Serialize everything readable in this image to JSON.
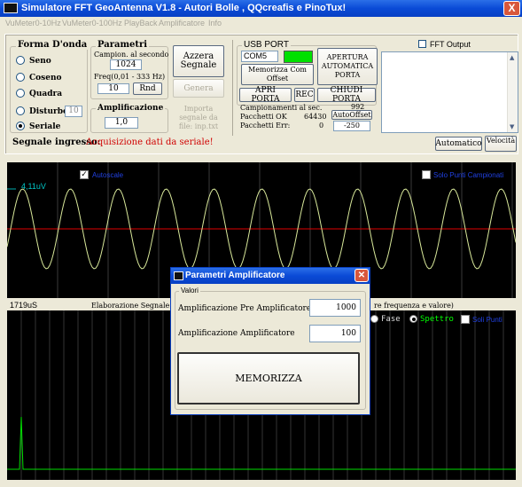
{
  "window": {
    "title": "Simulatore FFT GeoAntenna V1.8 - Autori Bolle , QQcreafis e PinoTux!",
    "close": "X"
  },
  "menu": [
    "VuMeter0-10Hz",
    "VuMeter0-100Hz",
    "PlayBack",
    "Amplificatore",
    "Info"
  ],
  "forma": {
    "title": "Forma D'onda",
    "options": [
      "Seno",
      "Coseno",
      "Quadra",
      "Disturbo",
      "Seriale"
    ],
    "selected": "Seriale",
    "disturbo_value": "10"
  },
  "parametri": {
    "title": "Parametri",
    "campion_label": "Campion. al secondo",
    "campion_value": "1024",
    "freq_label": "Freq(0,01 -  333  Hz)",
    "freq_value": "10",
    "rnd": "Rnd",
    "ampl_title": "Amplificazione",
    "ampl_value": "1,0"
  },
  "buttons": {
    "azzera": "Azzera Segnale",
    "genera": "Genera",
    "importa": "Importa segnale da file: inp.txt",
    "memorizza_com": "Memorizza Com Offset",
    "apertura": "APERTURA AUTOMATICA PORTA",
    "apri": "APRI PORTA",
    "rec": "REC",
    "chiudi": "CHIUDI PORTA",
    "autooffset": "AutoOffset",
    "automatico": "Automatico",
    "velocita": "Velocità"
  },
  "usb": {
    "title": "USB PORT",
    "com": "COM5",
    "camp_label": "Campionamenti al sec.",
    "camp_value": "992",
    "ok_label": "Pacchetti OK",
    "ok_value": "64430",
    "err_label": "Pacchetti Err:",
    "err_value": "0",
    "offset_value": "-250"
  },
  "fft": {
    "label": "FFT Output"
  },
  "signal": {
    "label": "Segnale ingresso:",
    "status": "Acquisizione dati da seriale!"
  },
  "scope_top": {
    "voltage": "4,11uV",
    "chk_label": "Autoscale",
    "chk2_label": "Solo Punti Campionati"
  },
  "middle": {
    "time": "1719uS",
    "elab_text": "Elaborazione Segnale con",
    "elab_tail": "re frequenza e valore)"
  },
  "scope_bottom": {
    "fase": "Fase",
    "spettro": "Spettro",
    "soli": "Soli Punti"
  },
  "colors": {
    "titlebar": "#0a4ad6",
    "scope_bg": "#000000",
    "wave": "#d8e89a",
    "redline": "#ff0000",
    "grid": "#555555",
    "spectrum": "#00dd00"
  },
  "dialog": {
    "title": "Parametri Amplificatore",
    "group": "Valori",
    "pre_label": "Amplificazione Pre Amplificatore",
    "pre_value": "1000",
    "amp_label": "Amplificazione Amplificatore",
    "amp_value": "100",
    "memorizza": "MEMORIZZA"
  }
}
